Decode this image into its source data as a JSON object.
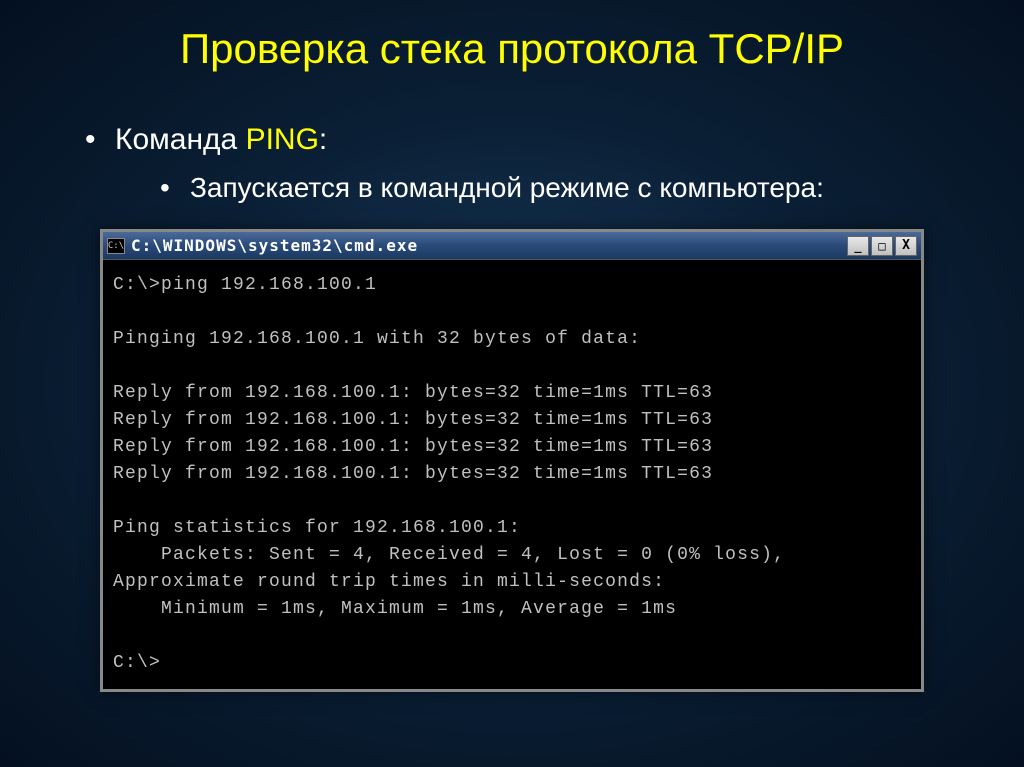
{
  "slide": {
    "title": "Проверка стека протокола TCP/IP",
    "bullet_prefix": "Команда ",
    "bullet_highlight": "PING",
    "bullet_suffix": ":",
    "sub_bullet": "Запускается в командной режиме с компьютера:"
  },
  "window": {
    "icon_text": "C:\\",
    "title": "C:\\WINDOWS\\system32\\cmd.exe",
    "minimize": "_",
    "maximize": "□",
    "close": "X"
  },
  "terminal": {
    "line1": "C:\\>ping 192.168.100.1",
    "blank1": "",
    "line2": "Pinging 192.168.100.1 with 32 bytes of data:",
    "blank2": "",
    "reply1": "Reply from 192.168.100.1: bytes=32 time=1ms TTL=63",
    "reply2": "Reply from 192.168.100.1: bytes=32 time=1ms TTL=63",
    "reply3": "Reply from 192.168.100.1: bytes=32 time=1ms TTL=63",
    "reply4": "Reply from 192.168.100.1: bytes=32 time=1ms TTL=63",
    "blank3": "",
    "stats1": "Ping statistics for 192.168.100.1:",
    "stats2": "    Packets: Sent = 4, Received = 4, Lost = 0 (0% loss),",
    "stats3": "Approximate round trip times in milli-seconds:",
    "stats4": "    Minimum = 1ms, Maximum = 1ms, Average = 1ms",
    "blank4": "",
    "prompt": "C:\\>"
  }
}
